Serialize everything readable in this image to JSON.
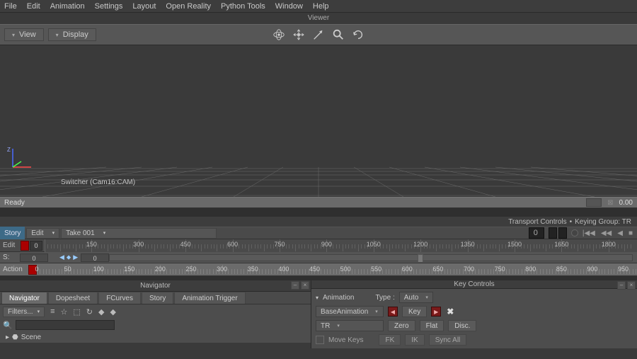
{
  "menu": {
    "items": [
      "File",
      "Edit",
      "Animation",
      "Settings",
      "Layout",
      "Open Reality",
      "Python Tools",
      "Window",
      "Help"
    ]
  },
  "viewer": {
    "label": "Viewer",
    "view_btn": "View",
    "display_btn": "Display",
    "camera_label": "Switcher (Cam16:CAM)",
    "tools": [
      "orbit-icon",
      "pan-icon",
      "dolly-icon",
      "loupe-icon",
      "undo-view-icon"
    ]
  },
  "status": {
    "left": "Ready",
    "right_value": "0.00"
  },
  "transport": {
    "label": "Transport Controls",
    "keying": "Keying Group: TR"
  },
  "take": {
    "story_label": "Story",
    "edit_label": "Edit",
    "take_label": "Take 001",
    "timecode": "0",
    "play_glyphs": [
      "|◀◀",
      "◀◀",
      "◀",
      "■"
    ]
  },
  "edit_ruler": {
    "label": "Edit",
    "start": "0",
    "ticks": [
      150,
      300,
      450,
      600,
      750,
      900,
      1050,
      1200,
      1350,
      1500,
      1650,
      1800
    ]
  },
  "slider": {
    "label": "S:",
    "left_val": "0",
    "right_val": "0"
  },
  "action_ruler": {
    "label": "Action",
    "ticks": [
      0,
      50,
      100,
      150,
      200,
      250,
      300,
      350,
      400,
      450,
      500,
      550,
      600,
      650,
      700,
      750,
      800,
      850,
      900,
      950
    ]
  },
  "navigator": {
    "title": "Navigator",
    "tabs": [
      "Navigator",
      "Dopesheet",
      "FCurves",
      "Story",
      "Animation Trigger"
    ],
    "active_tab": 0,
    "filters_label": "Filters...",
    "search_placeholder": "",
    "tree_root": "Scene"
  },
  "keycontrols": {
    "title": "Key Controls",
    "anim_label": "Animation",
    "type_label": "Type :",
    "type_value": "Auto",
    "layer_value": "BaseAnimation",
    "key_label": "Key",
    "tr_label": "TR",
    "zero": "Zero",
    "flat": "Flat",
    "disc": "Disc.",
    "move_keys": "Move Keys",
    "fk": "FK",
    "ik": "IK",
    "sync": "Sync All"
  }
}
